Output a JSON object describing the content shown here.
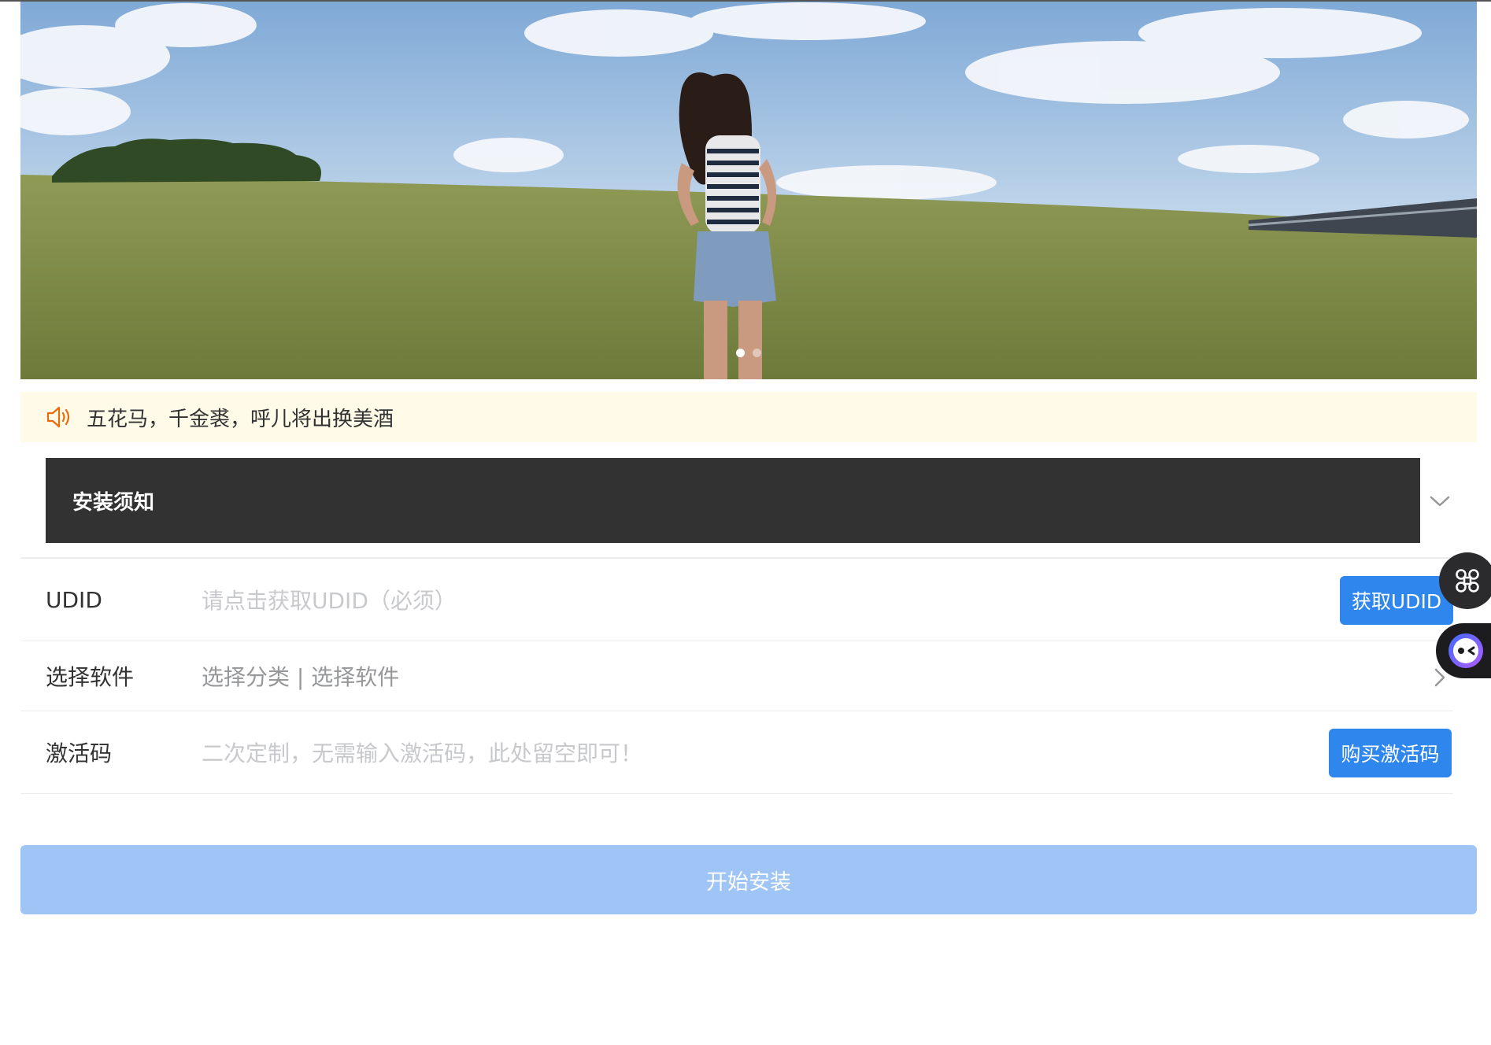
{
  "notice": {
    "icon": "volume-icon",
    "text": "五花马，千金裘，呼儿将出换美酒"
  },
  "collapse": {
    "title": "安装须知",
    "icon": "chevron-down-icon"
  },
  "form": {
    "udid": {
      "label": "UDID",
      "placeholder": "请点击获取UDID（必须）",
      "button": "获取UDID"
    },
    "software": {
      "label": "选择软件",
      "value": "选择分类 | 选择软件",
      "icon": "chevron-right-icon"
    },
    "code": {
      "label": "激活码",
      "placeholder": "二次定制，无需输入激活码，此处留空即可！",
      "button": "购买激活码"
    }
  },
  "install_button": "开始安装",
  "banner": {
    "slide_count": 2,
    "active_slide": 1
  },
  "colors": {
    "primary": "#2f86ed",
    "primary_disabled": "#9ec5f5",
    "notice_bg": "#fffbe8",
    "dark_panel": "#323233"
  }
}
